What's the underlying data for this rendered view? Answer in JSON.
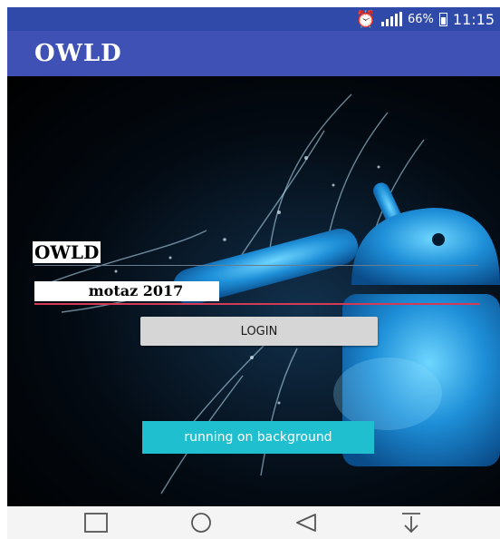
{
  "status_bar": {
    "battery_percent": "66%",
    "time": "11:15",
    "icons": [
      "alarm-icon",
      "signal-icon",
      "battery-icon"
    ]
  },
  "app_bar": {
    "title": "OWLD"
  },
  "form": {
    "brand_label": "OWLD",
    "password_value": "motaz 2017",
    "login_label": "LOGIN",
    "background_label": "running on background"
  },
  "nav_bar": {
    "icons": [
      "recents-icon",
      "home-icon",
      "back-icon",
      "notifications-down-icon"
    ]
  },
  "colors": {
    "status_bar": "#2f4aa8",
    "app_bar": "#3f51b5",
    "login_button": "#d6d6d6",
    "background_button": "#1fbfcf",
    "password_underline": "#d23a55"
  }
}
